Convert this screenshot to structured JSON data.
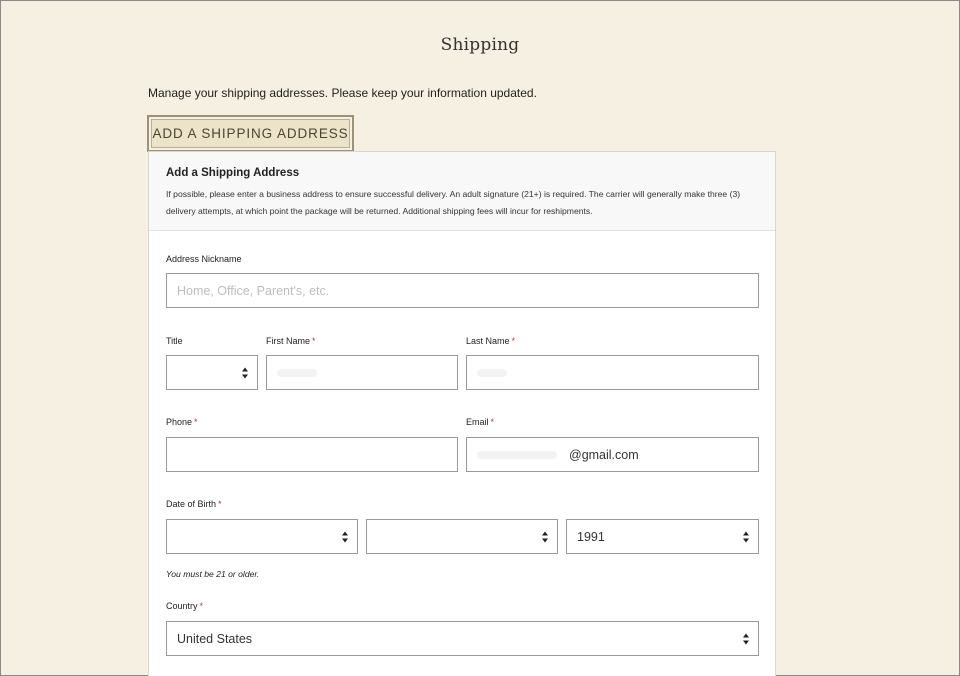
{
  "page": {
    "title": "Shipping",
    "intro": "Manage your shipping addresses. Please keep your information updated."
  },
  "add_button": {
    "label": "ADD A SHIPPING ADDRESS"
  },
  "panel": {
    "title": "Add a Shipping Address",
    "description": "If possible, please enter a business address to ensure successful delivery. An adult signature (21+) is required. The carrier will generally make three (3) delivery attempts, at which point the package will be returned. Additional shipping fees will incur for reshipments."
  },
  "form": {
    "required_mark": "*",
    "nickname": {
      "label": "Address Nickname",
      "placeholder": "Home, Office, Parent's, etc.",
      "value": ""
    },
    "title": {
      "label": "Title",
      "value": ""
    },
    "first_name": {
      "label": "First Name",
      "value": ""
    },
    "last_name": {
      "label": "Last Name",
      "value": ""
    },
    "phone": {
      "label": "Phone",
      "value": ""
    },
    "email": {
      "label": "Email",
      "value": "@gmail.com"
    },
    "dob": {
      "label": "Date of Birth",
      "month": "",
      "day": "",
      "year": "1991",
      "note": "You must be 21 or older."
    },
    "country": {
      "label": "Country",
      "value": "United States"
    }
  }
}
